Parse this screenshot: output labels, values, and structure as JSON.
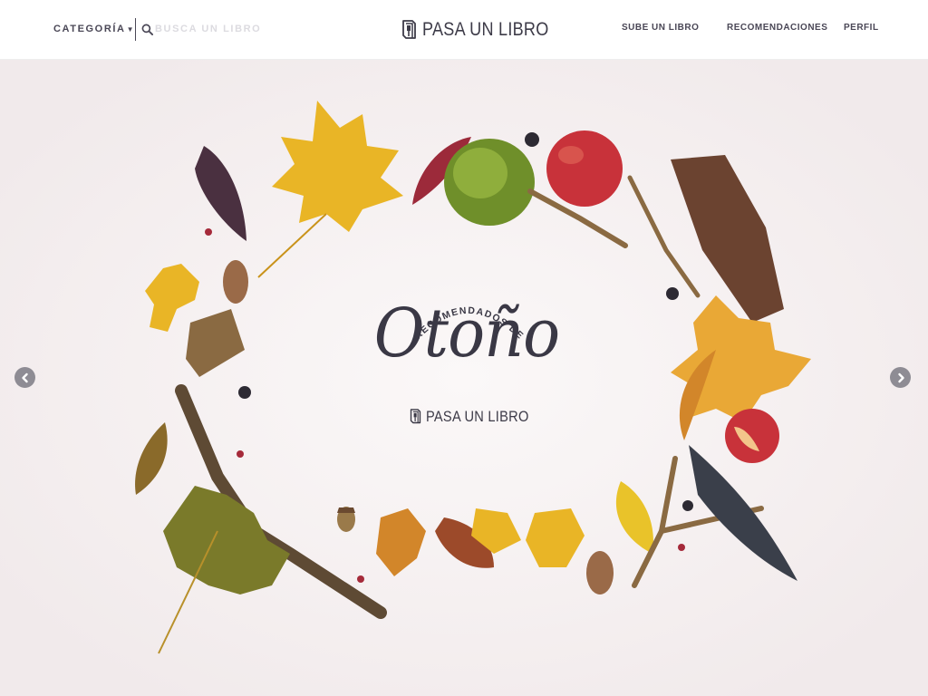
{
  "header": {
    "category_label": "CATEGORÍA",
    "search_placeholder": "BUSCA UN LIBRO",
    "logo_text": "PASA UN LIBRO",
    "nav": {
      "upload": "SUBE UN LIBRO",
      "recommendations": "RECOMENDACIONES",
      "profile": "PERFIL"
    }
  },
  "hero": {
    "arc_text": "RECOMENDADOS DE",
    "title": "Otoño",
    "brand": "PASA UN LIBRO",
    "prev_icon": "chevron-left-icon",
    "next_icon": "chevron-right-icon"
  },
  "colors": {
    "text_dark": "#3a3845",
    "hero_background": "#f6f1f2",
    "leaf_yellow": "#e8b421",
    "leaf_orange": "#d48a2a",
    "leaf_brown": "#8a5a32",
    "leaf_red": "#9c2a3a",
    "apple_red": "#c8323a",
    "moss_green": "#6f8f2a",
    "arrow_gray": "#8e8c94"
  }
}
